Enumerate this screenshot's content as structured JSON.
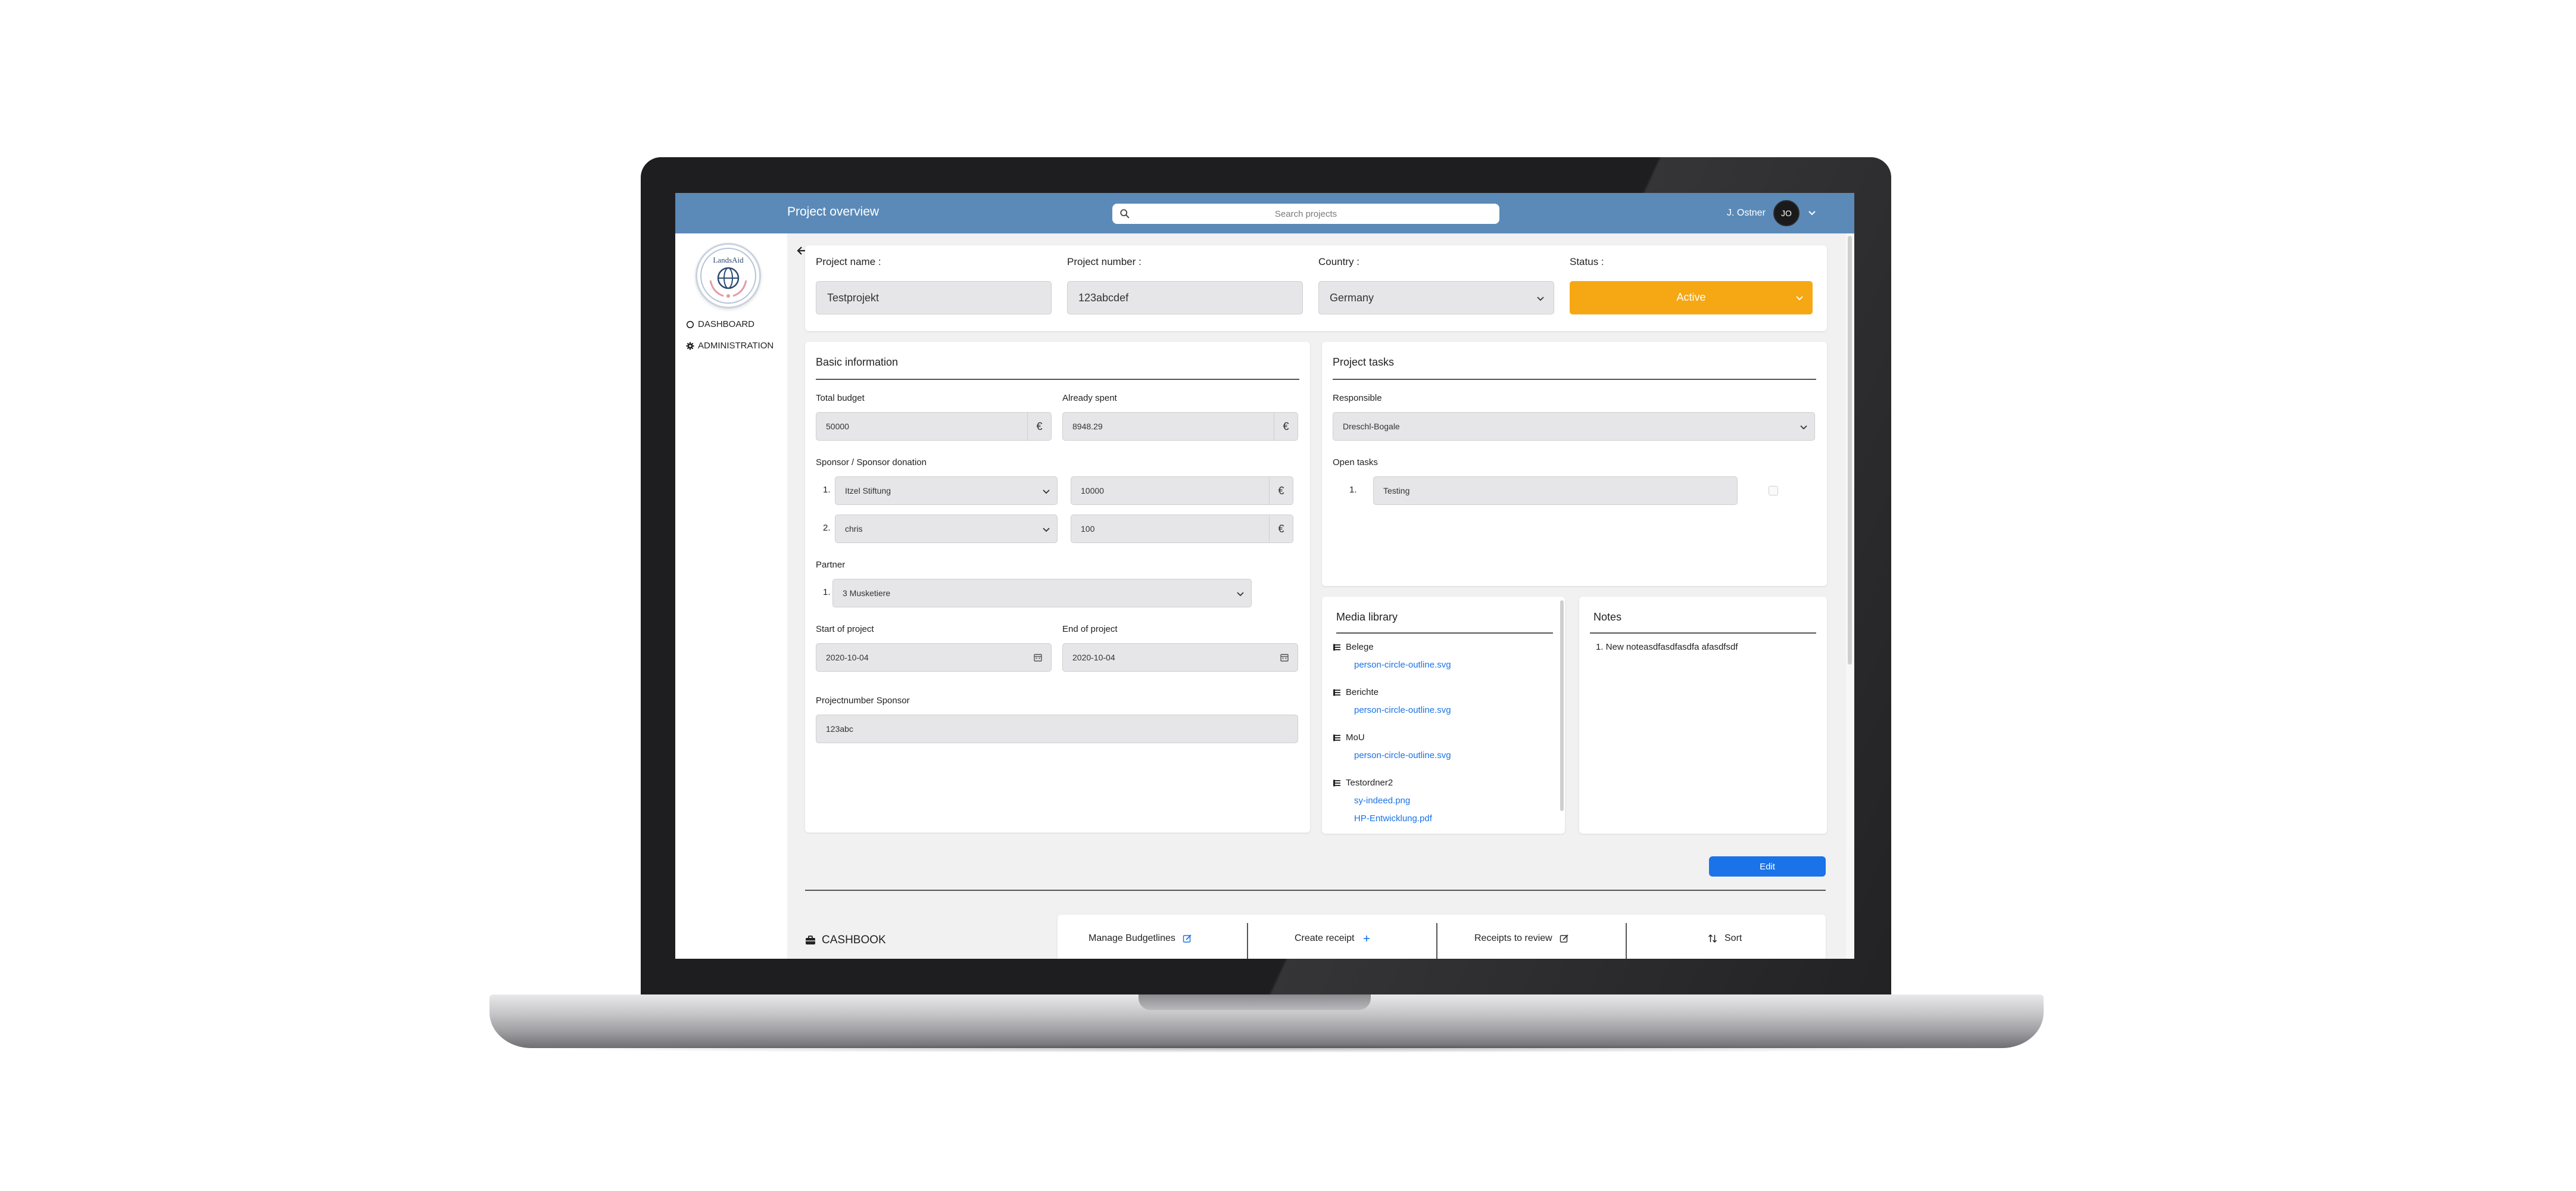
{
  "header": {
    "title": "Project overview",
    "search_placeholder": "Search projects",
    "user_name": "J. Ostner",
    "avatar_initials": "JO"
  },
  "sidebar": {
    "logo_text": "LandsAid",
    "items": [
      {
        "label": "DASHBOARD",
        "icon": "circle-outline-icon"
      },
      {
        "label": "ADMINISTRATION",
        "icon": "gear-icon"
      }
    ]
  },
  "project": {
    "name_label": "Project name :",
    "name_value": "Testprojekt",
    "number_label": "Project number :",
    "number_value": "123abcdef",
    "country_label": "Country :",
    "country_value": "Germany",
    "status_label": "Status :",
    "status_value": "Active",
    "status_color": "#f5a814"
  },
  "basic": {
    "title": "Basic information",
    "budget_label": "Total budget",
    "budget_value": "50000",
    "spent_label": "Already spent",
    "spent_value": "8948.29",
    "currency": "€",
    "sponsor_label": "Sponsor / Sponsor donation",
    "sponsors": [
      {
        "index": "1.",
        "name": "Itzel Stiftung",
        "amount": "10000"
      },
      {
        "index": "2.",
        "name": "chris",
        "amount": "100"
      }
    ],
    "partner_label": "Partner",
    "partners": [
      {
        "index": "1.",
        "name": "3 Musketiere"
      }
    ],
    "start_label": "Start of project",
    "start_value": "2020-10-04",
    "end_label": "End of project",
    "end_value": "2020-10-04",
    "projnum_sponsor_label": "Projectnumber Sponsor",
    "projnum_sponsor_value": "123abc"
  },
  "tasks": {
    "title": "Project tasks",
    "responsible_label": "Responsible",
    "responsible_value": "Dreschl-Bogale",
    "open_label": "Open tasks",
    "items": [
      {
        "index": "1.",
        "text": "Testing"
      }
    ]
  },
  "media": {
    "title": "Media library",
    "folders": [
      {
        "name": "Belege",
        "files": [
          "person-circle-outline.svg"
        ]
      },
      {
        "name": "Berichte",
        "files": [
          "person-circle-outline.svg"
        ]
      },
      {
        "name": "MoU",
        "files": [
          "person-circle-outline.svg"
        ]
      },
      {
        "name": "Testordner2",
        "files": [
          "sy-indeed.png",
          "HP-Entwicklung.pdf"
        ]
      }
    ]
  },
  "notes": {
    "title": "Notes",
    "items": [
      "1. New noteasdfasdfasdfa afasdfsdf"
    ]
  },
  "actions": {
    "edit_label": "Edit",
    "cashbook_label": "CASHBOOK",
    "toolbar": [
      {
        "label": "Manage Budgetlines",
        "icon": "edit-icon"
      },
      {
        "label": "Create receipt",
        "icon": "plus-icon"
      },
      {
        "label": "Receipts to review",
        "icon": "edit-icon"
      },
      {
        "label": "Sort",
        "icon": "sort-icon"
      }
    ]
  },
  "colors": {
    "header": "#5b8ab8",
    "accent": "#1a73e8",
    "status": "#f5a814"
  }
}
